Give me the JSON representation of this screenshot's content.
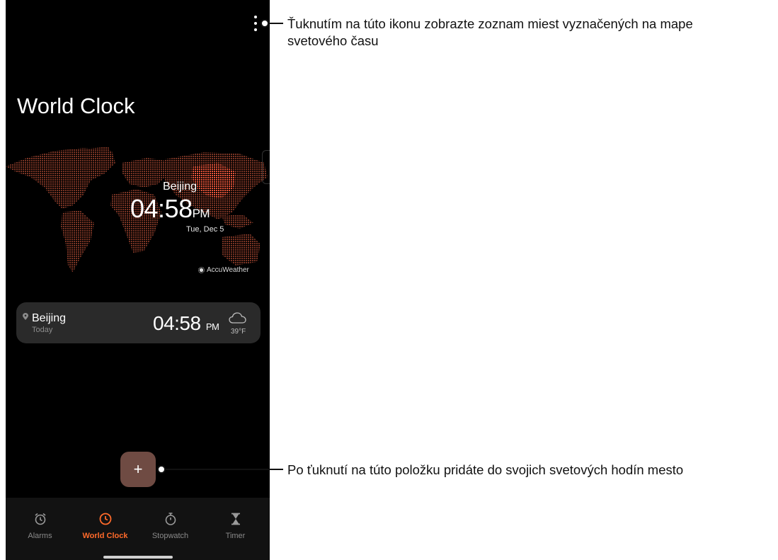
{
  "app": {
    "title": "World Clock",
    "map": {
      "city": "Beijing",
      "time": "04:58",
      "ampm": "PM",
      "date": "Tue, Dec 5",
      "provider": "AccuWeather"
    },
    "card": {
      "city": "Beijing",
      "day": "Today",
      "time": "04:58",
      "ampm": "PM",
      "temperature": "39°F",
      "weather_icon": "cloud-icon"
    },
    "fab_label": "+",
    "nav": [
      {
        "label": "Alarms",
        "icon": "alarm-clock-icon",
        "active": false
      },
      {
        "label": "World Clock",
        "icon": "clock-icon",
        "active": true
      },
      {
        "label": "Stopwatch",
        "icon": "stopwatch-icon",
        "active": false
      },
      {
        "label": "Timer",
        "icon": "hourglass-icon",
        "active": false
      }
    ]
  },
  "callouts": {
    "menu": "Ťuknutím na túto ikonu zobrazte zoznam miest vyznačených na mape svetového času",
    "add": "Po ťuknutí na túto položku pridáte do svojich svetových hodín mesto"
  },
  "colors": {
    "accent": "#ff6a2a",
    "map_dots": "#7a3424",
    "map_highlight": "#e8553a",
    "fab": "#6f4b43",
    "card": "#2a2a2a"
  }
}
